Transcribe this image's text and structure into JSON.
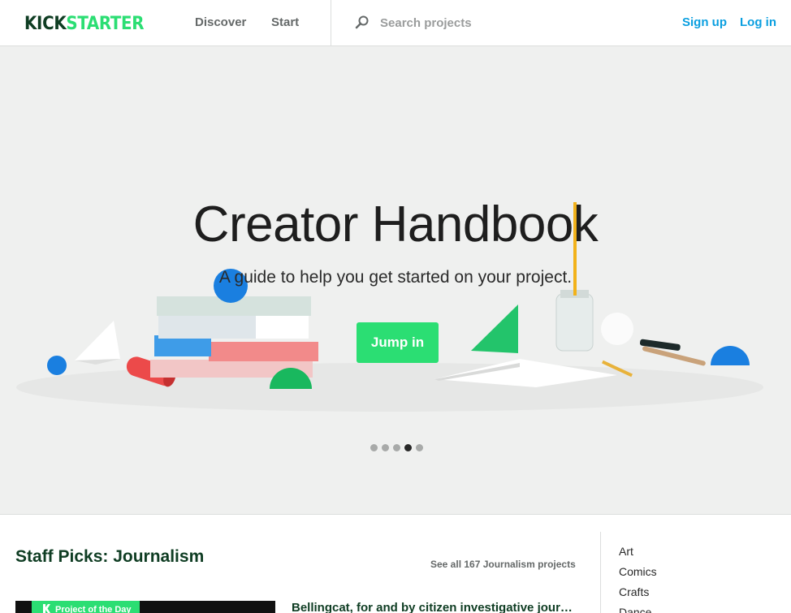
{
  "header": {
    "logo_kick": "KICK",
    "logo_starter": "STARTER",
    "nav": {
      "discover": "Discover",
      "start": "Start"
    },
    "search": {
      "placeholder": "Search projects"
    },
    "auth": {
      "sign_up": "Sign up",
      "log_in": "Log in"
    }
  },
  "hero": {
    "title": "Creator Handbook",
    "subtitle": "A guide to help you get started on your project.",
    "cta_label": "Jump in",
    "carousel": {
      "total": 5,
      "active_index": 3
    }
  },
  "staff_picks": {
    "title": "Staff Picks: Journalism",
    "see_all": "See all 167 Journalism projects",
    "featured": {
      "badge": "Project of the Day",
      "title": "Bellingcat, for and by citizen investigative journalists"
    }
  },
  "categories": [
    "Art",
    "Comics",
    "Crafts",
    "Dance"
  ],
  "colors": {
    "brand_green": "#2bde73",
    "brand_dark": "#0f3d23",
    "link_blue": "#0a9fe0",
    "hero_bg": "#eff0ef"
  },
  "icons": {
    "search": "magnifier-icon",
    "potd": "kickstarter-k-icon"
  }
}
